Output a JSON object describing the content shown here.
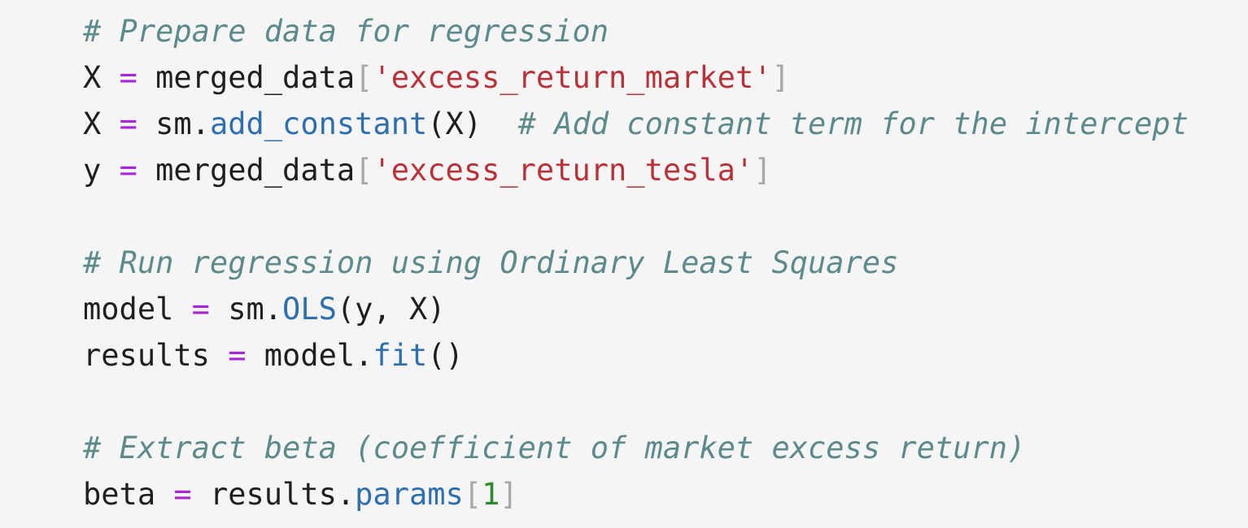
{
  "colors": {
    "background": "#f5f5f5",
    "text": "#1f1f1f",
    "comment": "#5d8a8a",
    "operator": "#a626d8",
    "string": "#b8323a",
    "bracket": "#a8a8a8",
    "function": "#2f6fae",
    "number": "#2c8a2c"
  },
  "code": {
    "comment_prepare": "# Prepare data for regression",
    "line_x1": {
      "var": "X ",
      "op": "=",
      "rhs": " merged_data",
      "open_bracket": "[",
      "string": "'excess_return_market'",
      "close_bracket": "]"
    },
    "line_x2": {
      "var": "X ",
      "op": "=",
      "obj": " sm.",
      "func": "add_constant",
      "args": "(X)",
      "comment": "  # Add constant term for the intercept"
    },
    "line_y": {
      "var": "y ",
      "op": "=",
      "rhs": " merged_data",
      "open_bracket": "[",
      "string": "'excess_return_tesla'",
      "close_bracket": "]"
    },
    "comment_run": "# Run regression using Ordinary Least Squares",
    "line_model": {
      "var": "model ",
      "op": "=",
      "obj": " sm.",
      "func": "OLS",
      "args": "(y, X)"
    },
    "line_results": {
      "var": "results ",
      "op": "=",
      "obj": " model.",
      "func": "fit",
      "args": "()"
    },
    "comment_extract": "# Extract beta (coefficient of market excess return)",
    "line_beta": {
      "var": "beta ",
      "op": "=",
      "obj": " results.",
      "func": "params",
      "open_bracket": "[",
      "number": "1",
      "close_bracket": "]"
    }
  }
}
